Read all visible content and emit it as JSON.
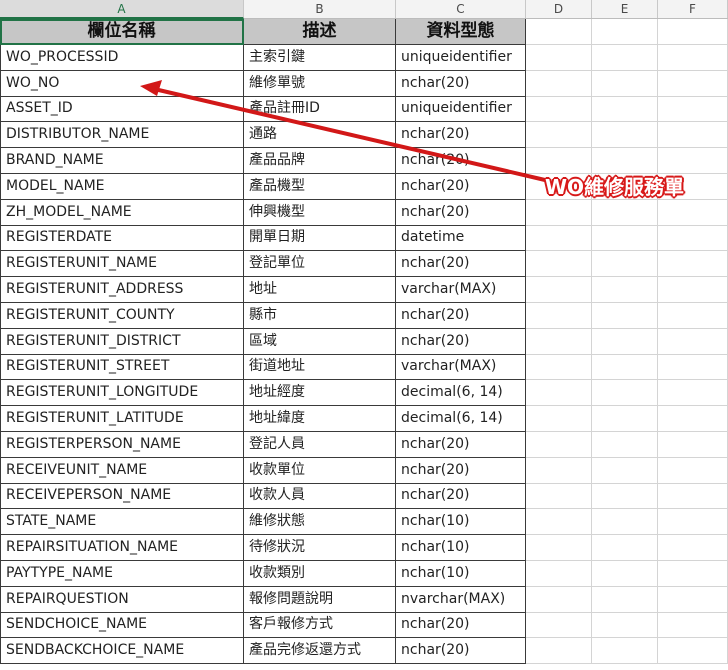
{
  "column_headers": [
    "A",
    "B",
    "C",
    "D",
    "E",
    "F"
  ],
  "table": {
    "headers": [
      "欄位名稱",
      "描述",
      "資料型態"
    ],
    "rows": [
      [
        "WO_PROCESSID",
        "主索引鍵",
        "uniqueidentifier"
      ],
      [
        "WO_NO",
        "維修單號",
        "nchar(20)"
      ],
      [
        "ASSET_ID",
        "產品註冊ID",
        "uniqueidentifier"
      ],
      [
        "DISTRIBUTOR_NAME",
        "通路",
        "nchar(20)"
      ],
      [
        "BRAND_NAME",
        "產品品牌",
        "nchar(20)"
      ],
      [
        "MODEL_NAME",
        "產品機型",
        "nchar(20)"
      ],
      [
        "ZH_MODEL_NAME",
        "伸興機型",
        "nchar(20)"
      ],
      [
        "REGISTERDATE",
        "開單日期",
        "datetime"
      ],
      [
        "REGISTERUNIT_NAME",
        "登記單位",
        "nchar(20)"
      ],
      [
        "REGISTERUNIT_ADDRESS",
        "地址",
        "varchar(MAX)"
      ],
      [
        "REGISTERUNIT_COUNTY",
        "縣市",
        "nchar(20)"
      ],
      [
        "REGISTERUNIT_DISTRICT",
        "區域",
        "nchar(20)"
      ],
      [
        "REGISTERUNIT_STREET",
        "街道地址",
        "varchar(MAX)"
      ],
      [
        "REGISTERUNIT_LONGITUDE",
        "地址經度",
        "decimal(6, 14)"
      ],
      [
        "REGISTERUNIT_LATITUDE",
        "地址緯度",
        "decimal(6, 14)"
      ],
      [
        "REGISTERPERSON_NAME",
        "登記人員",
        "nchar(20)"
      ],
      [
        "RECEIVEUNIT_NAME",
        "收款單位",
        "nchar(20)"
      ],
      [
        "RECEIVEPERSON_NAME",
        "收款人員",
        "nchar(20)"
      ],
      [
        "STATE_NAME",
        "維修狀態",
        "nchar(10)"
      ],
      [
        "REPAIRSITUATION_NAME",
        "待修狀況",
        "nchar(10)"
      ],
      [
        "PAYTYPE_NAME",
        "收款類別",
        "nchar(10)"
      ],
      [
        "REPAIRQUESTION",
        "報修問題說明",
        "nvarchar(MAX)"
      ],
      [
        "SENDCHOICE_NAME",
        "客戶報修方式",
        "nchar(20)"
      ],
      [
        "SENDBACKCHOICE_NAME",
        "產品完修返還方式",
        "nchar(20)"
      ]
    ]
  },
  "annotation": {
    "label": "WO維修服務單",
    "color": "#d21818"
  },
  "colors": {
    "header_fill": "#c6c6c6",
    "selection": "#217346",
    "gridline": "#d4d4d4"
  }
}
